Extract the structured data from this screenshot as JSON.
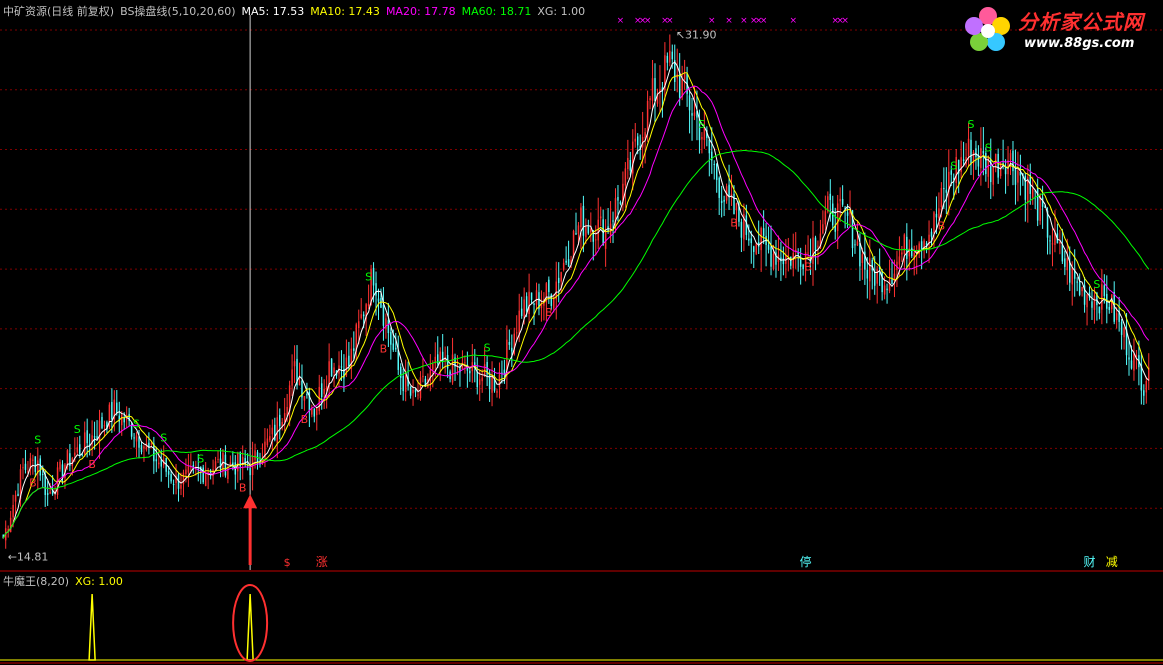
{
  "header": {
    "stock": "中矿资源(日线 前复权)",
    "indicator": "BS操盘线(5,10,20,60)",
    "ma5": "MA5: 17.53",
    "ma10": "MA10: 17.43",
    "ma20": "MA20: 17.78",
    "ma60": "MA60: 18.71",
    "xg": "XG: 1.00"
  },
  "sub_header": {
    "name": "牛魔王(8,20)",
    "xg": "XG: 1.00"
  },
  "logo": {
    "title": "分析家公式网",
    "url": "www.88gs.com"
  },
  "colors": {
    "up": "#ff3232",
    "down": "#54fcfc",
    "ma5": "#ffffff",
    "ma10": "#ffff00",
    "ma20": "#ff00ff",
    "ma60": "#00ff00",
    "label_s": "#00ff00",
    "label_b": "#ff3232",
    "grid": "#800000",
    "text": "#c0c0c0"
  },
  "chart_data": [
    {
      "type": "candlestick",
      "ylim": [
        14,
        32.5
      ],
      "anchors_close": [
        [
          0,
          15.0
        ],
        [
          8,
          17.3
        ],
        [
          14,
          17.6
        ],
        [
          18,
          16.4
        ],
        [
          25,
          17.5
        ],
        [
          35,
          18.3
        ],
        [
          45,
          19.3
        ],
        [
          52,
          18.7
        ],
        [
          60,
          17.8
        ],
        [
          70,
          16.9
        ],
        [
          80,
          17.2
        ],
        [
          88,
          17.5
        ],
        [
          100,
          17.4
        ],
        [
          110,
          18.5
        ],
        [
          118,
          20.6
        ],
        [
          126,
          19.3
        ],
        [
          132,
          20.8
        ],
        [
          140,
          20.8
        ],
        [
          150,
          23.9
        ],
        [
          160,
          20.6
        ],
        [
          166,
          19.6
        ],
        [
          176,
          20.8
        ],
        [
          188,
          20.6
        ],
        [
          200,
          20.2
        ],
        [
          210,
          22.7
        ],
        [
          222,
          23.2
        ],
        [
          234,
          25.6
        ],
        [
          244,
          25.3
        ],
        [
          252,
          26.9
        ],
        [
          262,
          29.6
        ],
        [
          270,
          30.9
        ],
        [
          276,
          29.9
        ],
        [
          282,
          28.8
        ],
        [
          292,
          26.4
        ],
        [
          300,
          25.4
        ],
        [
          310,
          24.6
        ],
        [
          318,
          24.4
        ],
        [
          326,
          24.6
        ],
        [
          334,
          25.9
        ],
        [
          342,
          25.7
        ],
        [
          350,
          23.9
        ],
        [
          358,
          23.7
        ],
        [
          366,
          24.8
        ],
        [
          376,
          25.3
        ],
        [
          384,
          27.2
        ],
        [
          392,
          28.0
        ],
        [
          400,
          27.4
        ],
        [
          406,
          27.8
        ],
        [
          412,
          27.2
        ],
        [
          418,
          26.3
        ],
        [
          426,
          24.8
        ],
        [
          436,
          23.3
        ],
        [
          448,
          22.9
        ],
        [
          454,
          21.7
        ],
        [
          462,
          20.2
        ],
        [
          464,
          20.9
        ]
      ],
      "xg_signal_index": 100,
      "b_marks": [
        12,
        36,
        97,
        122,
        154,
        221,
        296,
        326,
        380
      ],
      "s_marks": [
        14,
        30,
        54,
        65,
        80,
        148,
        196,
        283,
        385,
        392,
        399,
        443
      ],
      "high_label": "31.90",
      "low_label": "14.81",
      "event_labels": {
        "s_symbol": "$",
        "zhang": "涨",
        "ting": "停",
        "cai": "财",
        "jian": "减"
      }
    },
    {
      "type": "line",
      "series_name": "XG",
      "spikes": [
        36,
        100
      ]
    }
  ]
}
